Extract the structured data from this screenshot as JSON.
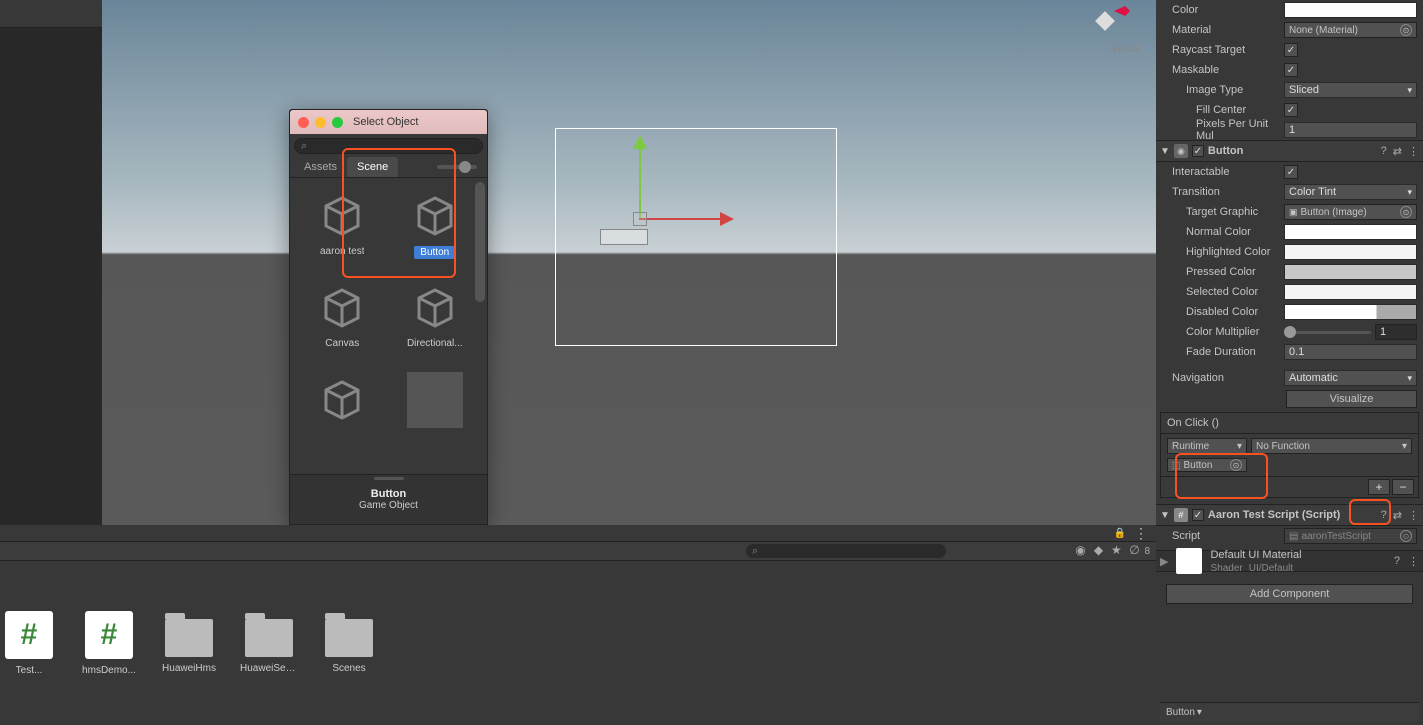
{
  "scene": {
    "back_label": "Back"
  },
  "popup": {
    "title": "Select Object",
    "tabs": {
      "assets": "Assets",
      "scene": "Scene"
    },
    "items": [
      {
        "label": "aaron test"
      },
      {
        "label": "Button",
        "selected": true
      },
      {
        "label": "Canvas"
      },
      {
        "label": "Directional..."
      },
      {
        "label": ""
      },
      {
        "label": "",
        "none": true
      }
    ],
    "footer_name": "Button",
    "footer_type": "Game Object"
  },
  "bottom": {
    "count": "8",
    "assets": [
      {
        "label": "Test...",
        "type": "script"
      },
      {
        "label": "hmsDemo...",
        "type": "script"
      },
      {
        "label": "HuaweiHms",
        "type": "folder"
      },
      {
        "label": "HuaweiService",
        "type": "folder"
      },
      {
        "label": "Scenes",
        "type": "folder"
      }
    ]
  },
  "inspector": {
    "image_props": {
      "color": "Color",
      "material": "Material",
      "material_value": "None (Material)",
      "raycast": "Raycast Target",
      "maskable": "Maskable",
      "image_type": "Image Type",
      "image_type_value": "Sliced",
      "fill_center": "Fill Center",
      "pixels_per_unit": "Pixels Per Unit Mul",
      "pixels_value": "1"
    },
    "button_component": {
      "name": "Button",
      "interactable": "Interactable",
      "transition": "Transition",
      "transition_value": "Color Tint",
      "target_graphic": "Target Graphic",
      "target_value": "Button (Image)",
      "normal_color": "Normal Color",
      "highlighted_color": "Highlighted Color",
      "pressed_color": "Pressed Color",
      "selected_color": "Selected Color",
      "disabled_color": "Disabled Color",
      "color_multiplier": "Color Multiplier",
      "cm_value": "1",
      "fade_duration": "Fade Duration",
      "fade_value": "0.1",
      "navigation": "Navigation",
      "navigation_value": "Automatic",
      "visualize": "Visualize"
    },
    "onclick": {
      "header": "On Click ()",
      "runtime": "Runtime",
      "function": "No Function",
      "object": "Button"
    },
    "script_component": {
      "name": "Aaron Test Script (Script)",
      "script_label": "Script",
      "script_value": "aaronTestScript"
    },
    "material": {
      "name": "Default UI Material",
      "shader_label": "Shader",
      "shader_value": "UI/Default"
    },
    "add_component": "Add Component",
    "breadcrumb": "Button"
  }
}
